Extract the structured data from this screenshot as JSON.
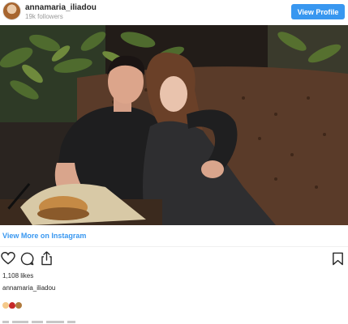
{
  "header": {
    "username": "annamaria_iliadou",
    "followers": "19k followers",
    "view_profile_label": "View Profile"
  },
  "post": {
    "photo_alt": "",
    "view_more_label": "View More on Instagram",
    "likes": "1,108 likes",
    "caption_username": "annamaria_iliadou",
    "emojis": [
      "baby-emoji",
      "heart-emoji",
      "girl-emoji"
    ]
  },
  "icons": {
    "like": "heart-outline-icon",
    "comment": "speech-bubble-icon",
    "share": "share-upload-icon",
    "save": "bookmark-icon"
  },
  "colors": {
    "accent": "#3897f0",
    "text": "#262626",
    "muted": "#999999"
  }
}
